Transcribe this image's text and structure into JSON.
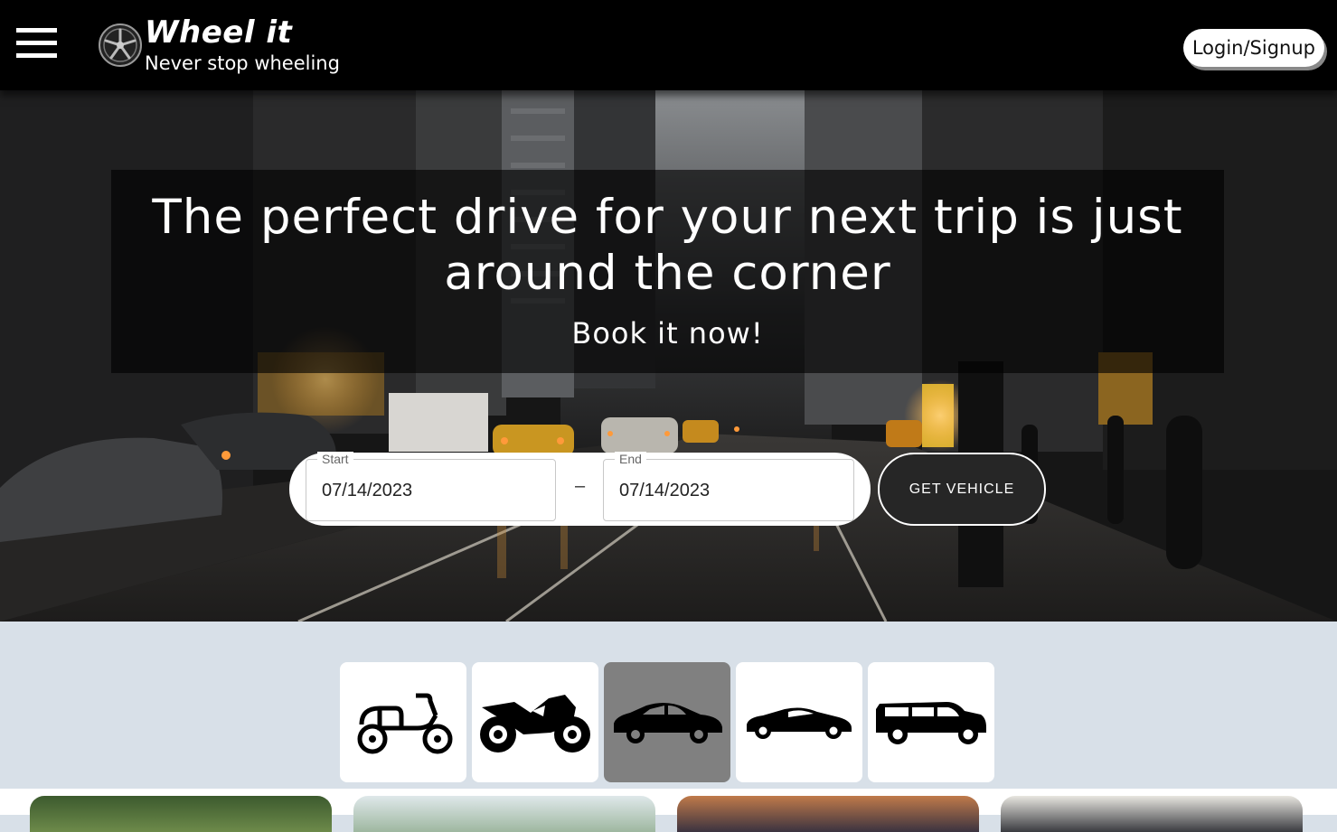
{
  "header": {
    "menu_icon": "hamburger-menu-icon",
    "logo_icon": "wheel-rim-icon",
    "brand_name": "Wheel it",
    "tagline": "Never stop wheeling",
    "login_label": "Login/Signup"
  },
  "hero": {
    "headline": "The perfect drive for your next trip is just around the corner",
    "subheadline": "Book it now!",
    "date_range": {
      "start_label": "Start",
      "start_value": "07/14/2023",
      "separator": "–",
      "end_label": "End",
      "end_value": "07/14/2023"
    },
    "get_vehicle_label": "GET VEHICLE"
  },
  "vehicle_types": [
    {
      "icon": "scooter-icon",
      "selected": false
    },
    {
      "icon": "motorbike-icon",
      "selected": false
    },
    {
      "icon": "sedan-car-icon",
      "selected": true
    },
    {
      "icon": "sports-car-icon",
      "selected": false
    },
    {
      "icon": "suv-icon",
      "selected": false
    }
  ],
  "colors": {
    "header_bg": "#000000",
    "page_bg": "#d8e0e8",
    "button_dark": "#262626",
    "selected_tile": "#808080"
  }
}
